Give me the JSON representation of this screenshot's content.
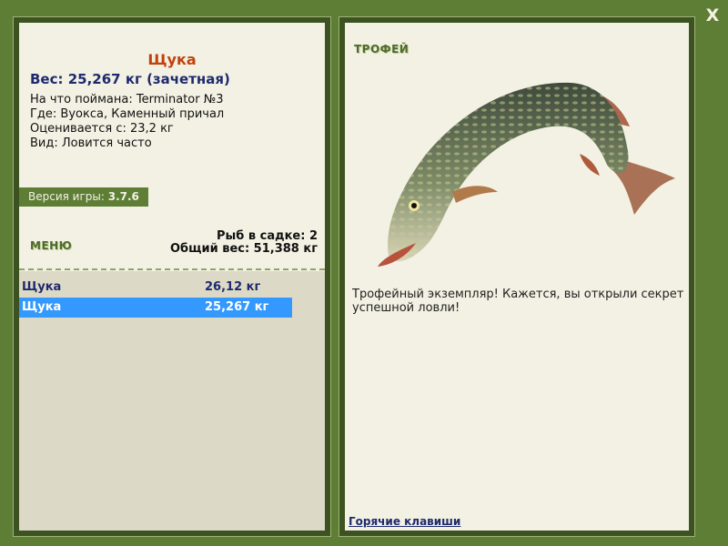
{
  "window": {
    "close_label": "X"
  },
  "fish": {
    "name": "Щука",
    "weight_line": "Вес: 25,267 кг (зачетная)",
    "bait": "На что поймана: Terminator №3",
    "location": "Где: Вуокса, Каменный причал",
    "valued_from": "Оценивается с: 23,2 кг",
    "species_status": "Вид: Ловится часто"
  },
  "version": {
    "label": "Версия игры: ",
    "value": "3.7.6"
  },
  "menu": {
    "label": "МЕНЮ"
  },
  "keepnet": {
    "count_text": "Рыб в садке: 2",
    "total_weight_text": "Общий вес: 51,388 кг"
  },
  "catches": [
    {
      "name": "Щука",
      "weight": "26,12 кг",
      "selected": false
    },
    {
      "name": "Щука",
      "weight": "25,267 кг",
      "selected": true
    }
  ],
  "trophy": {
    "label": "ТРОФЕЙ",
    "message": "Трофейный экземпляр! Кажется, вы открыли секрет успешной ловли!"
  },
  "hotkeys": {
    "label": "Горячие клавиши"
  },
  "colors": {
    "frame_bg": "#5e7e36",
    "panel_bg": "#f2f1e3",
    "fish_name": "#c2410c",
    "text_blue": "#1e2a6e",
    "selection": "#3399ff"
  }
}
